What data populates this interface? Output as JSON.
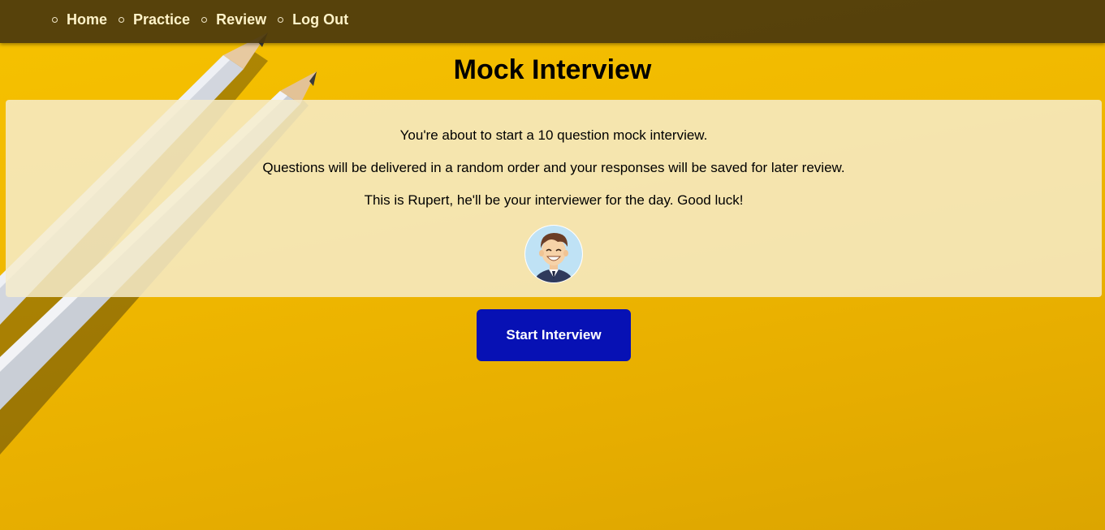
{
  "nav": {
    "items": [
      {
        "label": "Home"
      },
      {
        "label": "Practice"
      },
      {
        "label": "Review"
      },
      {
        "label": "Log Out"
      }
    ]
  },
  "main": {
    "title": "Mock Interview",
    "intro_lines": [
      "You're about to start a 10 question mock interview.",
      "Questions will be delivered in a random order and your responses will be saved for later review.",
      "This is Rupert, he'll be your interviewer for the day. Good luck!"
    ],
    "avatar_icon": "interviewer-avatar-icon",
    "start_button_label": "Start Interview"
  },
  "colors": {
    "background": "#f0b800",
    "navbar": "#4a380c",
    "nav_text": "#fff3c9",
    "panel": "#f6eccd",
    "button": "#0711b4"
  }
}
